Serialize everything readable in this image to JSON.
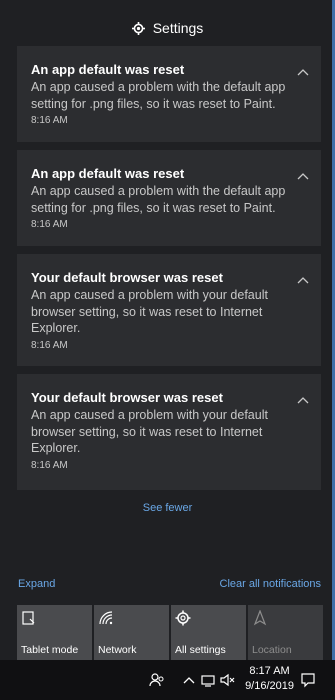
{
  "header": {
    "title": "Settings",
    "icon": "gear-icon"
  },
  "notifications": [
    {
      "title": "An app default was reset",
      "body": "An app caused a problem with the default app setting for .png files, so it was reset to Paint.",
      "time": "8:16 AM"
    },
    {
      "title": "An app default was reset",
      "body": "An app caused a problem with the default app setting for .png files, so it was reset to Paint.",
      "time": "8:16 AM"
    },
    {
      "title": "Your default browser was reset",
      "body": "An app caused a problem with your default browser setting, so it was reset to Internet Explorer.",
      "time": "8:16 AM"
    },
    {
      "title": "Your default browser was reset",
      "body": "An app caused a problem with your default browser setting, so it was reset to Internet Explorer.",
      "time": "8:16 AM"
    }
  ],
  "see_fewer": "See fewer",
  "actions": {
    "expand": "Expand",
    "clear_all": "Clear all notifications"
  },
  "quick_actions": [
    {
      "label": "Tablet mode",
      "icon": "tablet-mode-icon",
      "enabled": true
    },
    {
      "label": "Network",
      "icon": "network-icon",
      "enabled": true
    },
    {
      "label": "All settings",
      "icon": "gear-icon",
      "enabled": true
    },
    {
      "label": "Location",
      "icon": "location-icon",
      "enabled": false
    }
  ],
  "taskbar": {
    "time": "8:17 AM",
    "date": "9/16/2019",
    "icons": [
      "people-icon",
      "chevron-up-icon",
      "network-status-icon",
      "volume-muted-icon",
      "action-center-icon"
    ]
  },
  "colors": {
    "accent": "#6aa7e6",
    "card": "#2c2d30",
    "panel": "#1f2023",
    "tile": "#4a4b4e"
  }
}
